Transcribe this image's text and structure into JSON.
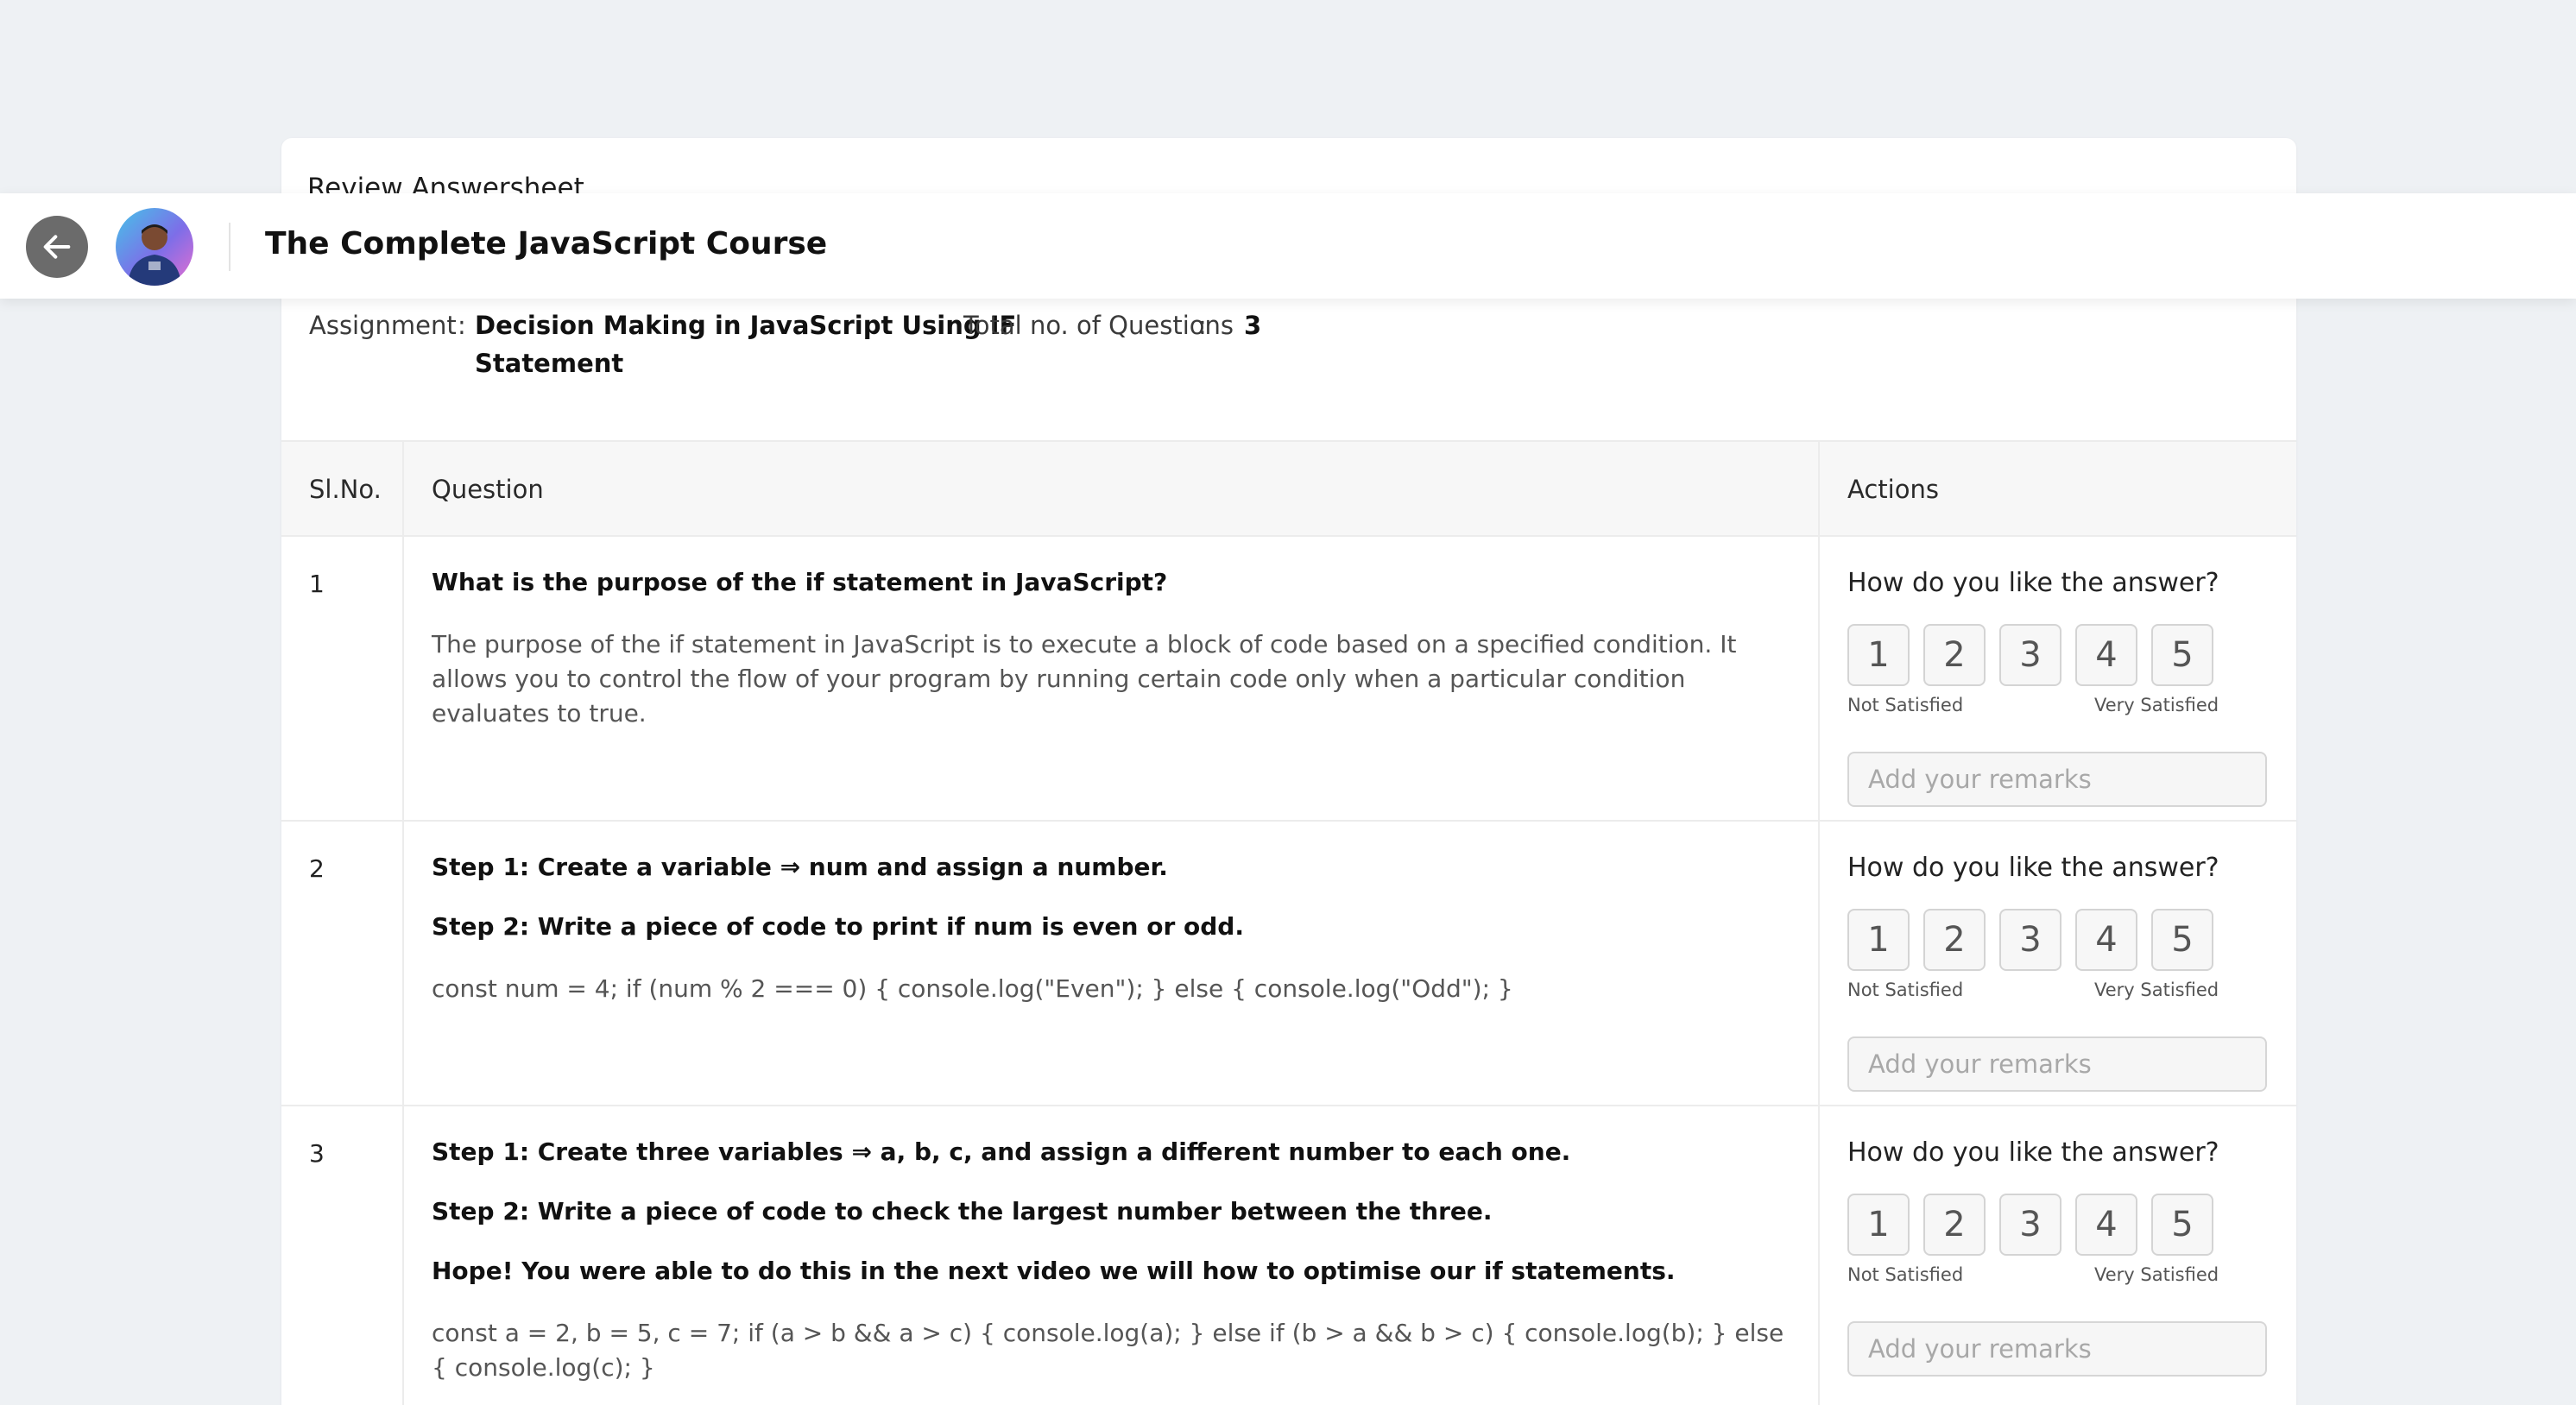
{
  "card": {
    "title": "Review Answersheet"
  },
  "header": {
    "course_title": "The Complete JavaScript Course"
  },
  "assignment": {
    "label": "Assignment",
    "name_line1": "Decision Making in JavaScript Using IF",
    "name_line2": "Statement",
    "total_label": "Total no. of Questions",
    "total_value": "3",
    "sep": ":"
  },
  "table": {
    "headers": {
      "slno": "Sl.No.",
      "question": "Question",
      "actions": "Actions"
    },
    "rows": [
      {
        "slno": "1",
        "question_lines": [
          "What is the purpose of the if statement in JavaScript?"
        ],
        "answer": "The purpose of the if statement in JavaScript is to execute a block of code based on a specified condition. It allows you to control the flow of your program by running certain code only when a particular condition evaluates to true."
      },
      {
        "slno": "2",
        "question_lines": [
          "Step 1: Create a variable ⇒ num and assign a number.",
          "Step 2: Write a piece of code to print if num is even or odd."
        ],
        "answer": "const num = 4; if (num % 2 === 0) { console.log(\"Even\"); } else { console.log(\"Odd\"); }"
      },
      {
        "slno": "3",
        "question_lines": [
          "Step 1: Create three variables ⇒ a, b, c, and assign a different number to each one.",
          "Step 2: Write a piece of code to check the largest number between the three.",
          "Hope! You were able to do this in the next video we will how to optimise our if statements."
        ],
        "answer": "const a = 2, b = 5, c = 7; if (a > b && a > c) { console.log(a); } else if (b > a && b > c) { console.log(b); } else { console.log(c); }"
      }
    ]
  },
  "actions": {
    "title": "How do you like the answer?",
    "ratings": [
      "1",
      "2",
      "3",
      "4",
      "5"
    ],
    "low_label": "Not Satisfied",
    "high_label": "Very Satisfied",
    "remarks_placeholder": "Add your remarks"
  },
  "icons": {
    "back": "arrow-left-icon",
    "avatar": "avatar-image"
  },
  "colors": {
    "back_button": "#6b6b6b",
    "page_bg": "#eef1f4"
  }
}
